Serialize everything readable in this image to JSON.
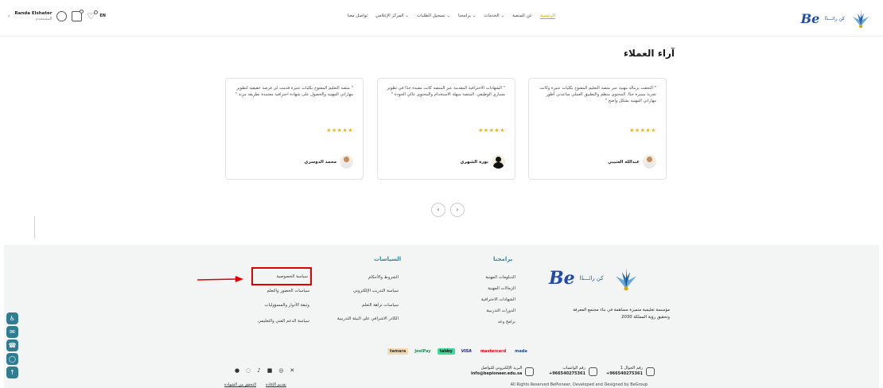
{
  "header": {
    "logo_text": "Be",
    "logo_sub": "كن رائـــدًا",
    "nav": [
      {
        "label": "الرئيسية",
        "active": true
      },
      {
        "label": "عن المنصة",
        "active": false
      },
      {
        "label": "الخدمات ⌄",
        "active": false
      },
      {
        "label": "برامجنا ⌄",
        "active": false
      },
      {
        "label": "تسجيل الطلبات ⌄",
        "active": false
      },
      {
        "label": "المركز الإعلامي ⌄",
        "active": false
      },
      {
        "label": "تواصل معنا",
        "active": false
      }
    ],
    "user_name": "Randa Elshater",
    "user_role": "المستخدم",
    "lang": "EN",
    "accent": "#d9a400"
  },
  "testimonials": {
    "title": "آراء العملاء",
    "cards": [
      {
        "text": "\" التحقت بزمالة مهنية عبر منصة التعليم المفتوح بكليات عنيزة وكانت تجربة مميزة جدًا. المحتوى منظم والتطبيق العملي ساعدني أطور مهاراتي المهنية بشكل واضح \"",
        "stars": "★★★★★",
        "name": "عبدالله العتيبي",
        "avatar": "male"
      },
      {
        "text": "\" الشهادات الاحترافية المقدمة عبر المنصة كانت مفيدة جدًا في تطوير مساري الوظيفي. المنصة سهلة الاستخدام والمحتوى عالي الجودة \"",
        "stars": "★★★★★",
        "name": "نورة الشهري",
        "avatar": "female"
      },
      {
        "text": "\" منصة التعليم المفتوح بكليات عنيزة قدمت لي فرصة حقيقية لتطوير مهاراتي المهنية والحصول على شهادة احترافية معتمدة بطريقة مرنة \"",
        "stars": "★★★★★",
        "name": "محمد الدوسري",
        "avatar": "male"
      }
    ],
    "prev_label": "‹",
    "next_label": "›"
  },
  "footer": {
    "programs_title": "برامجنا",
    "programs": [
      "الدبلومات المهنية",
      "الزمالات المهنية",
      "الشهادات الاحترافية",
      "الدورات التدريبية",
      "برامج وعد"
    ],
    "policies_title": "السياسات",
    "policies_col1": [
      "الشروط والأحكام",
      "سياسة التدريب الإلكتروني",
      "سياسات نزاهة التعلم",
      "الكادر الاشرافي على البيئة التدريبية"
    ],
    "policies_col2": [
      "سياسة الخصوصية",
      "سياسات الحضور والتعلم",
      "وثيقة الأدوار والمسؤوليات",
      "سياسة الدعم الفني والتعليمي"
    ],
    "mission": "مؤسسة تعليمية متميزة مساهمة في بناء مجتمع المعرفة وتحقيق رؤية المملكة 2030",
    "payments": [
      "tamara",
      "JeelPay",
      "tabby",
      "VISA",
      "mastercard",
      "mada"
    ],
    "phone_label": "رقم الجوال 1",
    "phone": "+966540275361",
    "whatsapp_label": "رقم الواتساب",
    "whatsapp": "+966540275361",
    "email_label": "البريد الإلكتروني للتواصل",
    "email": "info@bepioneer.edu.sa",
    "copyright": "All Rights Reserved BePioneer, Developed and Designed by BeGroup",
    "bottom_links": [
      "تقديم الإفادة",
      "التحقق من الشهادة"
    ],
    "social_icons": [
      "telegram-icon",
      "snapchat-icon",
      "tiktok-icon",
      "linkedin-icon",
      "instagram-icon",
      "x-icon"
    ]
  },
  "side_buttons": [
    "accessibility-icon",
    "mail-icon",
    "phone-icon",
    "whatsapp-icon",
    "scroll-top-icon"
  ],
  "colors": {
    "teal": "#2e7d91",
    "brand_blue": "#1f4aa8",
    "star": "#f2b600",
    "highlight": "#e00000"
  }
}
